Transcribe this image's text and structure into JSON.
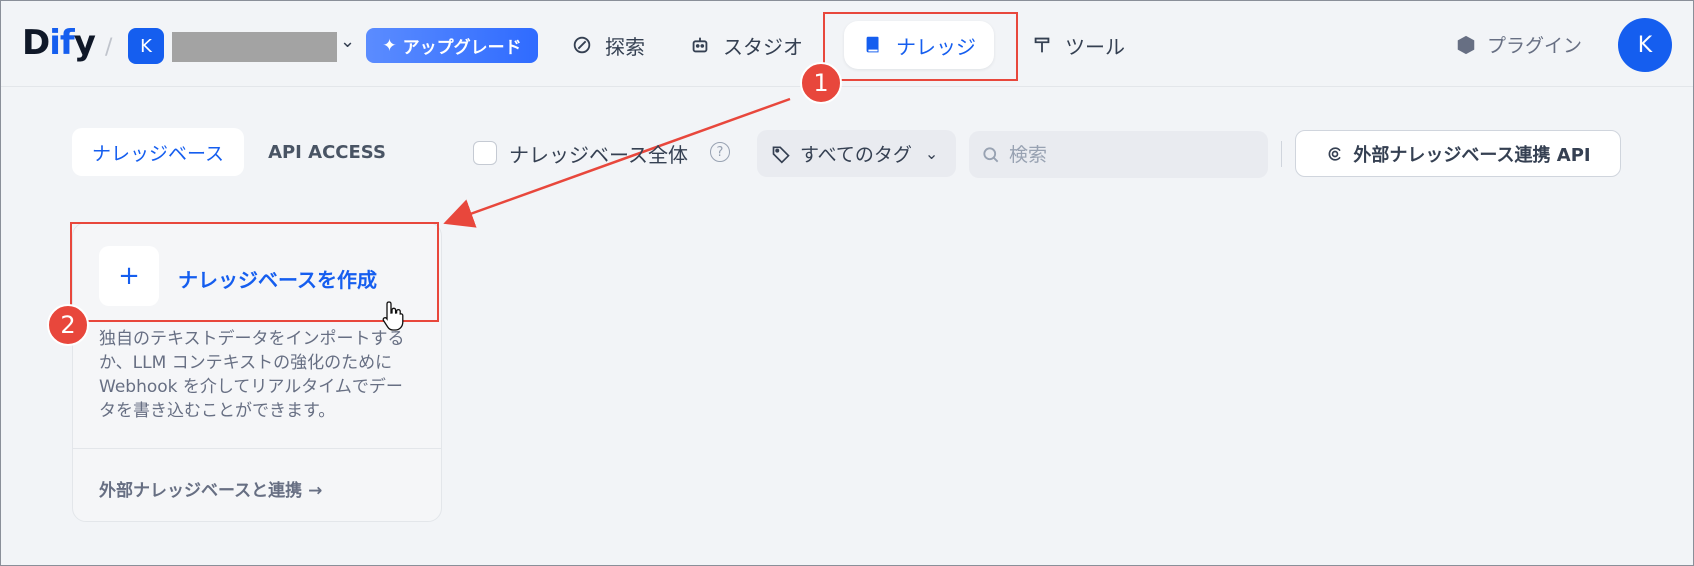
{
  "brand": {
    "logo": "Dify"
  },
  "workspace": {
    "initial": "K"
  },
  "upgrade_label": "アップグレード",
  "nav": {
    "explore": "探索",
    "studio": "スタジオ",
    "knowledge": "ナレッジ",
    "tools": "ツール",
    "plugins": "プラグイン"
  },
  "user": {
    "initial": "K"
  },
  "annotations": {
    "step1": "1",
    "step2": "2"
  },
  "tabs": {
    "knowledge_base": "ナレッジベース",
    "api_access": "API ACCESS"
  },
  "filters": {
    "all_checkbox_label": "ナレッジベース全体",
    "tags_select": "すべてのタグ",
    "search_placeholder": "検索",
    "external_api_button": "外部ナレッジベース連携 API"
  },
  "create_card": {
    "plus": "+",
    "title": "ナレッジベースを作成",
    "description": "独自のテキストデータをインポートするか、LLM コンテキストの強化のために Webhook を介してリアルタイムでデータを書き込むことができます。",
    "link": "外部ナレッジベースと連携 →"
  },
  "colors": {
    "accent": "#155eef",
    "highlight": "#e8473c",
    "background": "#f2f4f7"
  }
}
